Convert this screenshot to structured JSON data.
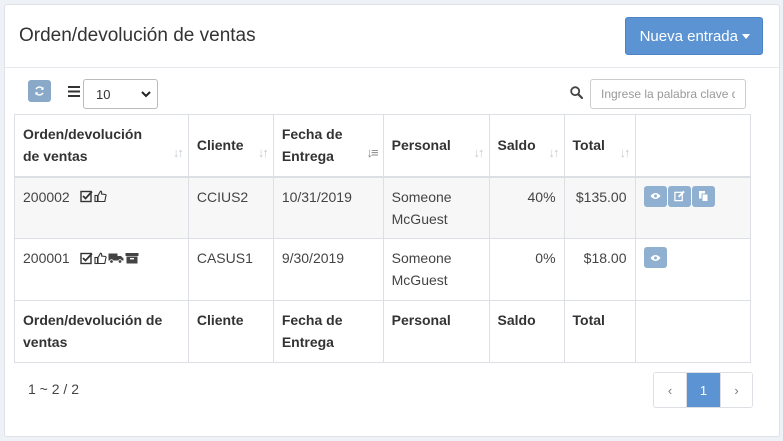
{
  "header": {
    "title": "Orden/devolución de ventas",
    "new_button_label": "Nueva entrada"
  },
  "toolbar": {
    "page_size": "10",
    "search_placeholder": "Ingrese la palabra clave d"
  },
  "table": {
    "columns": [
      {
        "label": "Orden/devolución de ventas"
      },
      {
        "label": "Cliente"
      },
      {
        "label": "Fecha de Entrega"
      },
      {
        "label": "Personal"
      },
      {
        "label": "Saldo"
      },
      {
        "label": "Total"
      },
      {
        "label": ""
      }
    ],
    "rows": [
      {
        "order": "200002",
        "client": "CCIUS2",
        "date": "10/31/2019",
        "staff": "Someone McGuest",
        "balance": "40%",
        "total": "$135.00",
        "status_icons": [
          "check-square-icon",
          "thumbs-up-icon"
        ],
        "actions": [
          "view-icon",
          "edit-icon",
          "copy-icon"
        ]
      },
      {
        "order": "200001",
        "client": "CASUS1",
        "date": "9/30/2019",
        "staff": "Someone McGuest",
        "balance": "0%",
        "total": "$18.00",
        "status_icons": [
          "check-square-icon",
          "thumbs-up-icon",
          "truck-icon",
          "archive-icon"
        ],
        "actions": [
          "view-icon"
        ]
      }
    ],
    "footer_columns": [
      "Orden/devolución de ventas",
      "Cliente",
      "Fecha de Entrega",
      "Personal",
      "Saldo",
      "Total",
      ""
    ]
  },
  "footer": {
    "info": "1 ~ 2 / 2",
    "pagination": {
      "prev": "‹",
      "current": "1",
      "next": "›"
    }
  },
  "colors": {
    "primary": "#5b93d3",
    "action_button": "#8fb0d0"
  }
}
